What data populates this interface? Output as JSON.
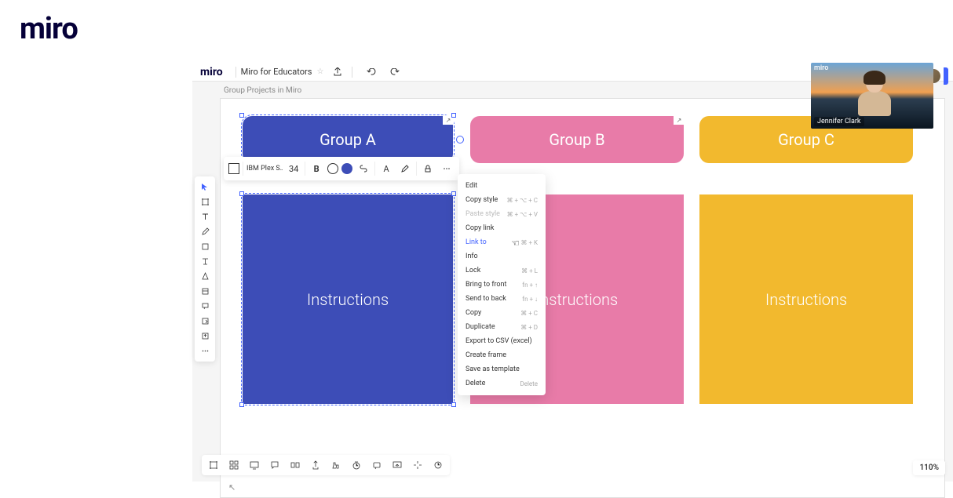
{
  "top_logo": "miro",
  "app": {
    "logo": "miro",
    "board_name": "Miro for Educators",
    "breadcrumb": "Group Projects in Miro"
  },
  "groups": {
    "a": {
      "title": "Group A",
      "instructions": "Instructions"
    },
    "b": {
      "title": "Group B",
      "instructions": "Instructions"
    },
    "c": {
      "title": "Group C",
      "instructions": "Instructions"
    }
  },
  "ctx_toolbar": {
    "font": "IBM Plex S…",
    "font_size": "34",
    "bold": "B",
    "text_style": "A"
  },
  "menu": {
    "edit": "Edit",
    "copy_style": {
      "label": "Copy style",
      "shortcut": "⌘ + ⌥ + C"
    },
    "paste_style": {
      "label": "Paste style",
      "shortcut": "⌘ + ⌥ + V"
    },
    "copy_link": "Copy link",
    "link_to": {
      "label": "Link to",
      "shortcut": "⌘ + K"
    },
    "info": "Info",
    "lock": {
      "label": "Lock",
      "shortcut": "⌘ + L"
    },
    "bring_front": {
      "label": "Bring to front",
      "shortcut": "fn + ↑"
    },
    "send_back": {
      "label": "Send to back",
      "shortcut": "fn + ↓"
    },
    "copy": {
      "label": "Copy",
      "shortcut": "⌘ + C"
    },
    "duplicate": {
      "label": "Duplicate",
      "shortcut": "⌘ + D"
    },
    "export_csv": "Export to CSV (excel)",
    "create_frame": "Create frame",
    "save_template": "Save as template",
    "delete": {
      "label": "Delete",
      "shortcut": "Delete"
    }
  },
  "zoom": "110%",
  "video": {
    "top_label": "miro",
    "name": "Jennifer Clark"
  }
}
